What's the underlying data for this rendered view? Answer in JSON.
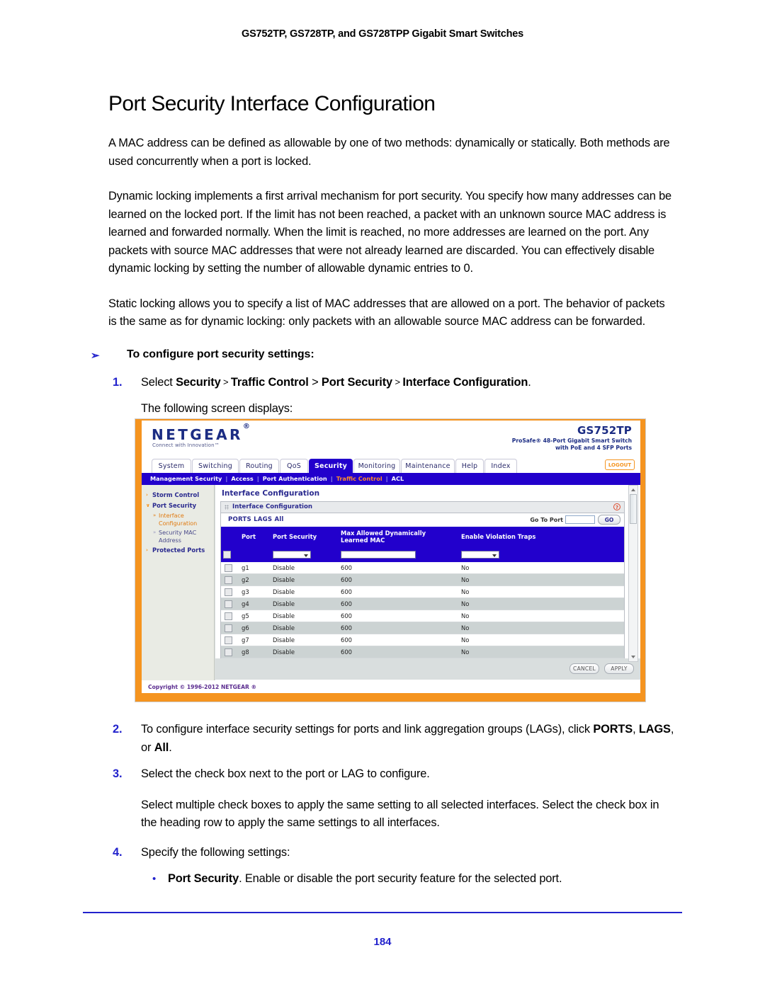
{
  "document": {
    "running_header": "GS752TP, GS728TP, and GS728TPP Gigabit Smart Switches",
    "title": "Port Security Interface Configuration",
    "page_number": "184",
    "paragraphs": [
      "A MAC address can be defined as allowable by one of two methods: dynamically or statically. Both methods are used concurrently when a port is locked.",
      "Dynamic locking implements a first arrival mechanism for port security. You specify how many addresses can be learned on the locked port. If the limit has not been reached, a packet with an unknown source MAC address is learned and forwarded normally. When the limit is reached, no more addresses are learned on the port. Any packets with source MAC addresses that were not already learned are discarded. You can effectively disable dynamic locking by setting the number of allowable dynamic entries to 0.",
      "Static locking allows you to specify a list of MAC addresses that are allowed on a port. The behavior of packets is the same as for dynamic locking: only packets with an allowable source MAC address can be forwarded."
    ],
    "procedure_heading": "To configure port security settings:",
    "procedure_arrow": "➢",
    "steps": {
      "step1_num": "1.",
      "step1_select": "Select",
      "step1_path1": "Security",
      "step1_path2": "Traffic Control",
      "step1_path3": "Port Security",
      "step1_path4": "Interface Configuration",
      "step1_period": ".",
      "step1_follow": "The following screen displays:",
      "step2_num": "2.",
      "step2_text_a": "To configure interface security settings for ports and link aggregation groups (LAGs), click ",
      "step2_bold1": "PORTS",
      "step2_comma1": ", ",
      "step2_bold2": "LAGS",
      "step2_or": ", or ",
      "step2_bold3": "All",
      "step2_period": ".",
      "step3_num": "3.",
      "step3_text": "Select the check box next to the port or LAG to configure.",
      "step3_sub": "Select multiple check boxes to apply the same setting to all selected interfaces. Select the check box in the heading row to apply the same settings to all interfaces.",
      "step4_num": "4.",
      "step4_text": "Specify the following settings:",
      "bullet_dot": "•",
      "bullet1_bold": "Port Security",
      "bullet1_text": ". Enable or disable the port security feature for the selected port."
    }
  },
  "device_ui": {
    "brand": "NETGEAR",
    "brand_trademark": "®",
    "brand_tagline": "Connect with Innovation™",
    "model": "GS752TP",
    "model_desc_line1": "ProSafe® 48-Port Gigabit Smart Switch",
    "model_desc_line2": "with PoE and 4 SFP Ports",
    "tabs": [
      {
        "label": "System",
        "active": false
      },
      {
        "label": "Switching",
        "active": false
      },
      {
        "label": "Routing",
        "active": false
      },
      {
        "label": "QoS",
        "active": false
      },
      {
        "label": "Security",
        "active": true
      },
      {
        "label": "Monitoring",
        "active": false
      },
      {
        "label": "Maintenance",
        "active": false
      },
      {
        "label": "Help",
        "active": false
      },
      {
        "label": "Index",
        "active": false
      }
    ],
    "logout_label": "LOGOUT",
    "submenu": [
      {
        "label": "Management Security",
        "active": false
      },
      {
        "label": "Access",
        "active": false
      },
      {
        "label": "Port Authentication",
        "active": false
      },
      {
        "label": "Traffic Control",
        "active": true
      },
      {
        "label": "ACL",
        "active": false
      }
    ],
    "submenu_separator": "|",
    "sidebar": [
      {
        "label": "Storm Control",
        "caret": "›",
        "type": "item",
        "active": false
      },
      {
        "label": "Port Security",
        "caret": "∨",
        "type": "item",
        "active": false
      },
      {
        "label": "Interface Configuration",
        "caret": "»",
        "type": "sub",
        "active": true
      },
      {
        "label": "Security MAC Address",
        "caret": "»",
        "type": "sub",
        "active": false
      },
      {
        "label": "Protected Ports",
        "caret": "›",
        "type": "item",
        "active": false
      }
    ],
    "panel_title": "Interface Configuration",
    "card_title": "Interface Configuration",
    "help_icon_glyph": "?",
    "ports_lags_all": "PORTS LAGS All",
    "go_to_port_label": "Go To Port",
    "go_to_port_value": "",
    "go_button_label": "GO",
    "table": {
      "columns": [
        "",
        "Port",
        "Port Security",
        "Max Allowed Dynamically Learned MAC",
        "Enable Violation Traps"
      ],
      "filter_row": {
        "port_security_value": "",
        "max_allowed_value": "",
        "violation_traps_value": ""
      },
      "rows": [
        {
          "port": "g1",
          "port_security": "Disable",
          "max_allowed": "600",
          "violation_traps": "No"
        },
        {
          "port": "g2",
          "port_security": "Disable",
          "max_allowed": "600",
          "violation_traps": "No"
        },
        {
          "port": "g3",
          "port_security": "Disable",
          "max_allowed": "600",
          "violation_traps": "No"
        },
        {
          "port": "g4",
          "port_security": "Disable",
          "max_allowed": "600",
          "violation_traps": "No"
        },
        {
          "port": "g5",
          "port_security": "Disable",
          "max_allowed": "600",
          "violation_traps": "No"
        },
        {
          "port": "g6",
          "port_security": "Disable",
          "max_allowed": "600",
          "violation_traps": "No"
        },
        {
          "port": "g7",
          "port_security": "Disable",
          "max_allowed": "600",
          "violation_traps": "No"
        },
        {
          "port": "g8",
          "port_security": "Disable",
          "max_allowed": "600",
          "violation_traps": "No"
        }
      ]
    },
    "cancel_label": "CANCEL",
    "apply_label": "APPLY",
    "copyright": "Copyright © 1996-2012 NETGEAR ®"
  },
  "colors": {
    "brand_orange": "#f5941f",
    "nav_blue": "#2200cc",
    "link_blue": "#2222cc",
    "netgear_navy": "#1b2c83"
  }
}
